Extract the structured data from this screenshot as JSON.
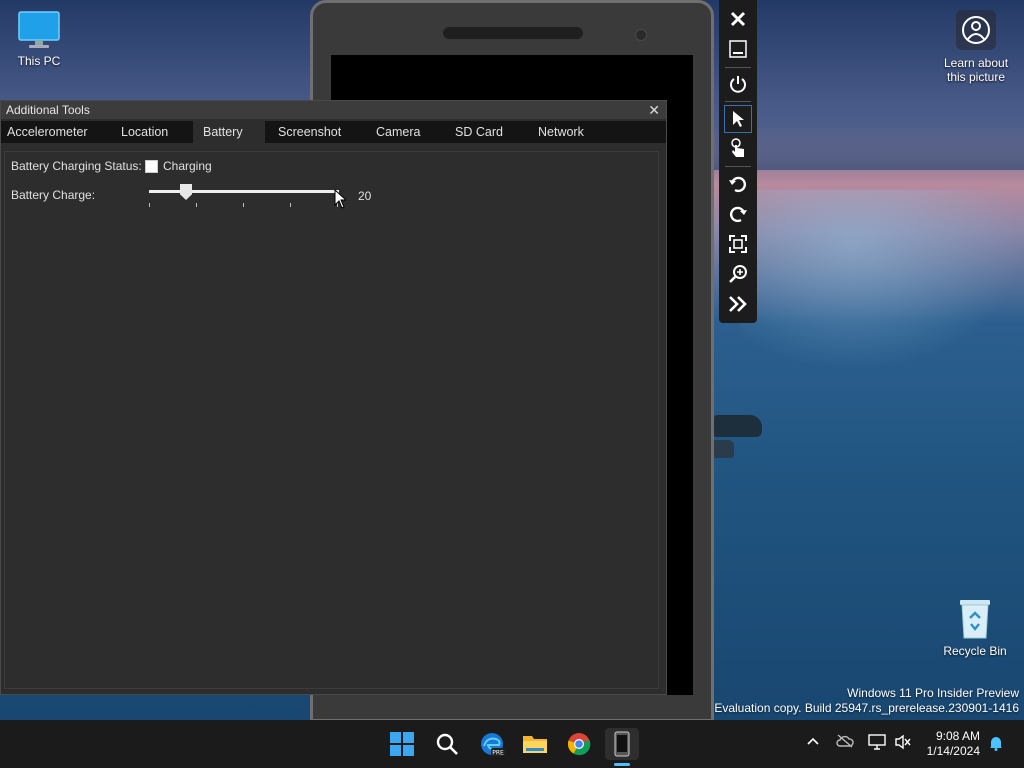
{
  "desktop": {
    "this_pc_label": "This PC",
    "recycle_bin_label": "Recycle Bin",
    "learn_line1": "Learn about",
    "learn_line2": "this picture"
  },
  "tools_window": {
    "title": "Additional Tools",
    "close_glyph": "✕",
    "tabs": [
      {
        "label": "Accelerometer"
      },
      {
        "label": "Location"
      },
      {
        "label": "Battery",
        "active": true
      },
      {
        "label": "Screenshot"
      },
      {
        "label": "Camera"
      },
      {
        "label": "SD Card"
      },
      {
        "label": "Network"
      }
    ],
    "battery": {
      "status_label": "Battery Charging Status:",
      "charging_label": "Charging",
      "charging_checked": false,
      "charge_label": "Battery Charge:",
      "charge_value": "20",
      "charge_min": 0,
      "charge_max": 100
    }
  },
  "emulator_toolbar": {
    "icons": [
      "close-icon",
      "minimize-icon",
      "power-icon",
      "pointer-icon",
      "touch-icon",
      "rotate-left-icon",
      "rotate-right-icon",
      "fit-screen-icon",
      "zoom-icon",
      "more-tools-icon"
    ]
  },
  "taskbar": {
    "icons": [
      "windows-start-icon",
      "search-icon",
      "edge-preview-icon",
      "file-explorer-icon",
      "chrome-icon",
      "phone-emulator-icon"
    ],
    "time": "9:08 AM",
    "date": "1/14/2024"
  },
  "watermark": {
    "line1": "Windows 11 Pro Insider Preview",
    "line2": "Evaluation copy. Build 25947.rs_prerelease.230901-1416"
  },
  "colors": {
    "accent": "#4cc2ff",
    "window_bg": "#2d2d2d",
    "tab_bar_bg": "#141414"
  }
}
